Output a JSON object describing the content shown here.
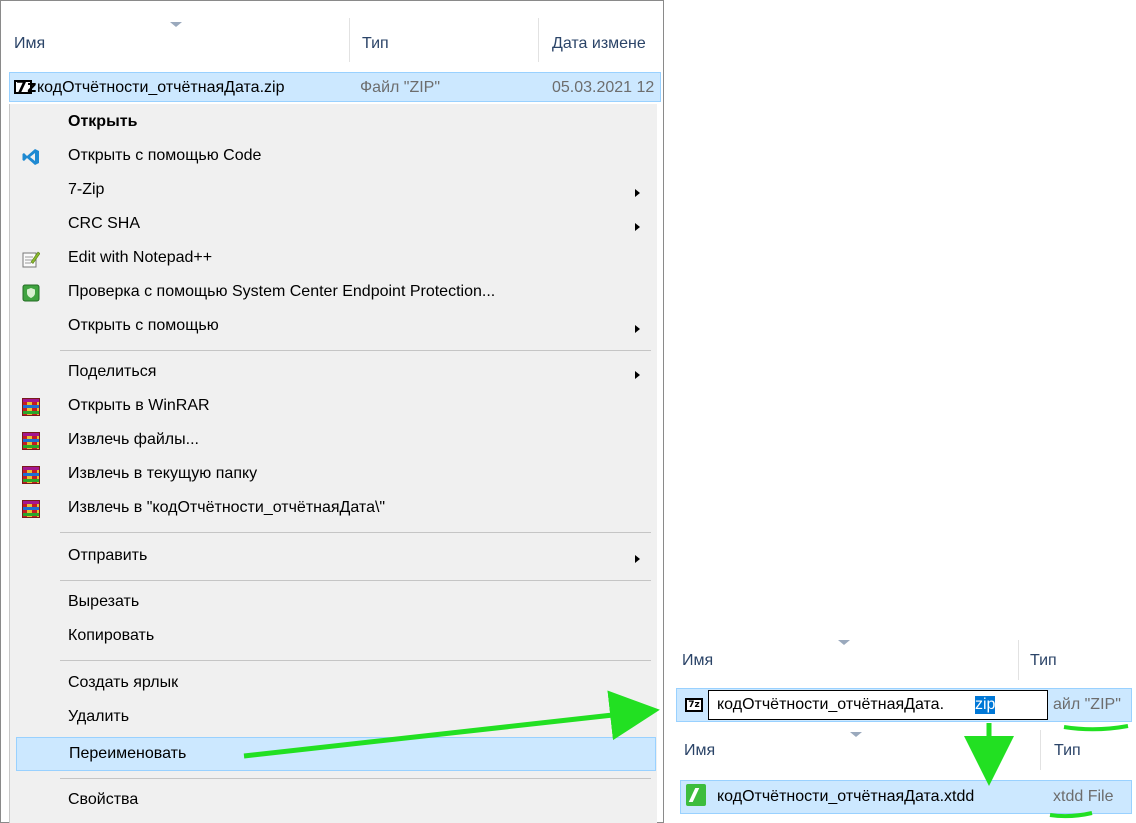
{
  "explorer": {
    "columns": {
      "name": "Имя",
      "type": "Тип",
      "date": "Дата измене"
    },
    "file": {
      "name": "кодОтчётности_отчётнаяДата.zip",
      "type": "Файл \"ZIP\"",
      "date": "05.03.2021 12"
    }
  },
  "context_menu": {
    "items": [
      {
        "label": "Открыть",
        "bold": true
      },
      {
        "label": "Открыть с помощью Code",
        "icon": "vscode-icon"
      },
      {
        "label": "7-Zip",
        "submenu": true
      },
      {
        "label": "CRC SHA",
        "submenu": true
      },
      {
        "label": "Edit with Notepad++",
        "icon": "notepadpp-icon"
      },
      {
        "label": "Проверка с помощью System Center Endpoint Protection...",
        "icon": "endpoint-protection-icon"
      },
      {
        "label": "Открыть с помощью",
        "submenu": true
      },
      {
        "label": "Поделиться",
        "submenu": true
      },
      {
        "label": "Открыть в WinRAR",
        "icon": "winrar-icon"
      },
      {
        "label": "Извлечь файлы...",
        "icon": "winrar-icon"
      },
      {
        "label": "Извлечь в текущую папку",
        "icon": "winrar-icon"
      },
      {
        "label": "Извлечь в \"кодОтчётности_отчётнаяДата\\\"",
        "icon": "winrar-icon"
      },
      {
        "label": "Отправить",
        "submenu": true
      },
      {
        "label": "Вырезать"
      },
      {
        "label": "Копировать"
      },
      {
        "label": "Создать ярлык"
      },
      {
        "label": "Удалить"
      },
      {
        "label": "Переименовать",
        "highlighted": true
      },
      {
        "label": "Свойства"
      }
    ]
  },
  "rename_step": {
    "columns": {
      "name": "Имя",
      "type": "Тип"
    },
    "edit_base": "кодОтчётности_отчётнаяДата.",
    "edit_selected_ext": "zip",
    "type_partial": "айл \"ZIP\""
  },
  "result_step": {
    "columns": {
      "name": "Имя",
      "type": "Тип"
    },
    "file_name": "кодОтчётности_отчётнаяДата.xtdd",
    "file_type": "xtdd File"
  },
  "colors": {
    "annotation": "#22e022",
    "selection": "#cce8ff",
    "text_select": "#0078d7"
  }
}
